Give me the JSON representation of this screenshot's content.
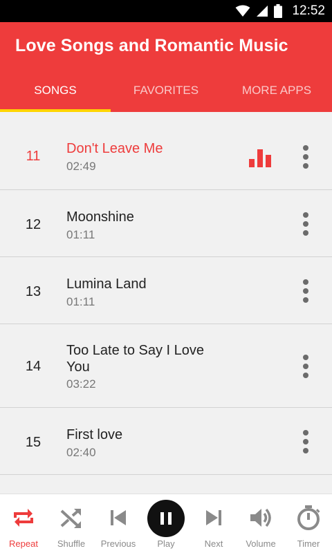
{
  "status_bar": {
    "time": "12:52"
  },
  "app": {
    "title": "Love Songs and Romantic Music",
    "tabs": [
      {
        "label": "SONGS",
        "active": true
      },
      {
        "label": "FAVORITES",
        "active": false
      },
      {
        "label": "MORE APPS",
        "active": false
      }
    ]
  },
  "songs": [
    {
      "number": "11",
      "title": "Don't Leave Me",
      "duration": "02:49",
      "playing": true
    },
    {
      "number": "12",
      "title": "Moonshine",
      "duration": "01:11",
      "playing": false
    },
    {
      "number": "13",
      "title": "Lumina Land",
      "duration": "01:11",
      "playing": false
    },
    {
      "number": "14",
      "title": "Too Late to Say I Love You",
      "duration": "03:22",
      "playing": false
    },
    {
      "number": "15",
      "title": "First love",
      "duration": "02:40",
      "playing": false
    }
  ],
  "controls": {
    "repeat": "Repeat",
    "shuffle": "Shuffle",
    "previous": "Previous",
    "play": "Play",
    "next": "Next",
    "volume": "Volume",
    "timer": "Timer"
  },
  "colors": {
    "accent": "#ee3c3c",
    "tab_indicator": "#ffd400",
    "status_bar": "#000000"
  }
}
